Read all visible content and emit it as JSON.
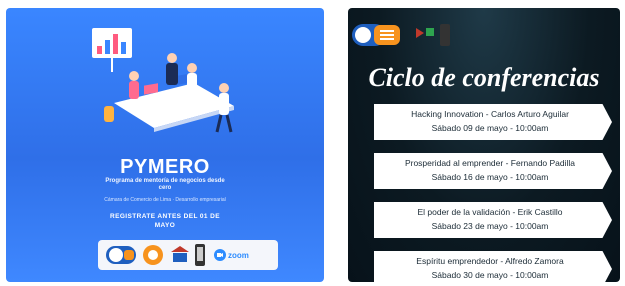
{
  "left_poster": {
    "title": "PYMERO",
    "subtitle": "Programa de mentoría de negocios desde cero",
    "note": "Cámara de Comercio de Lima · Desarrollo empresarial",
    "cta": "REGISTRATE ANTES DEL 01 DE MAYO",
    "logos": {
      "zoom_label": "zoom"
    }
  },
  "right_poster": {
    "title": "Ciclo de conferencias",
    "items": [
      {
        "line1": "Hacking Innovation - Carlos Arturo Aguilar",
        "line2": "Sábado 09 de mayo - 10:00am"
      },
      {
        "line1": "Prosperidad al emprender - Fernando Padilla",
        "line2": "Sábado 16 de mayo - 10:00am"
      },
      {
        "line1": "El poder de la validación - Erik Castillo",
        "line2": "Sábado 23 de mayo - 10:00am"
      },
      {
        "line1": "Espíritu emprendedor - Alfredo Zamora",
        "line2": "Sábado 30 de mayo - 10:00am"
      }
    ]
  },
  "colors": {
    "left_bg": "#3a86ff",
    "right_bg": "#0c1a22",
    "accent_orange": "#f7931e",
    "accent_blue": "#1f5fbf"
  }
}
